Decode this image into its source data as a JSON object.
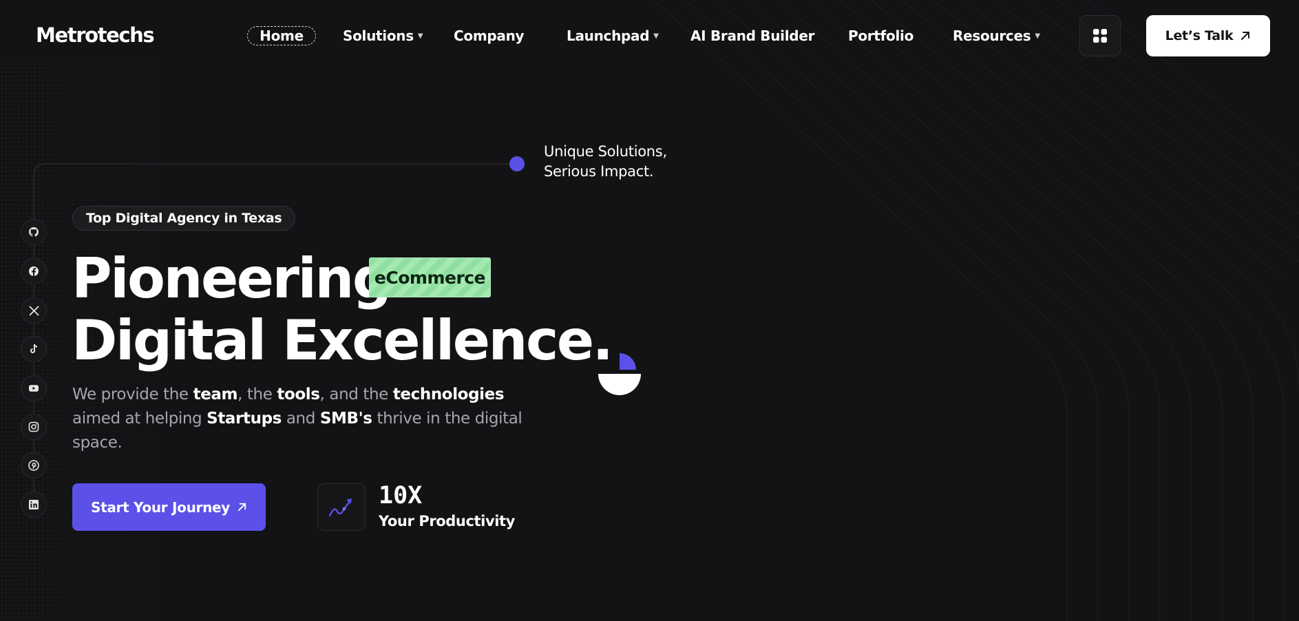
{
  "brand": {
    "logo": "Metrotechs"
  },
  "nav": {
    "items": [
      {
        "label": "Home",
        "has_dropdown": false,
        "active": true
      },
      {
        "label": "Solutions",
        "has_dropdown": true
      },
      {
        "label": "Company",
        "has_dropdown": false
      },
      {
        "label": "Launchpad",
        "has_dropdown": true
      },
      {
        "label": "AI Brand Builder",
        "has_dropdown": false
      },
      {
        "label": "Portfolio",
        "has_dropdown": false
      },
      {
        "label": "Resources",
        "has_dropdown": true
      }
    ],
    "menu_icon": "grid-icon",
    "cta_label": "Let’s Talk",
    "cta_icon": "arrow-up-right-icon"
  },
  "hero": {
    "tagline_line1": "Unique Solutions,",
    "tagline_line2": "Serious Impact.",
    "badge": "Top Digital Agency in Texas",
    "headline_line1": "Pioneering",
    "headline_highlight": "eCommerce",
    "headline_line2": "Digital Excellence.",
    "description": {
      "p1": "We provide the ",
      "b1": "team",
      "p2": ", the ",
      "b2": "tools",
      "p3": ", and the ",
      "b3": "technologies",
      "p4": " aimed at helping ",
      "b4": "Startups",
      "p5": " and ",
      "b5": "SMB's",
      "p6": " thrive in the digital space."
    },
    "cta_label": "Start Your Journey",
    "stat_value": "10X",
    "stat_label": "Your Productivity",
    "stat_icon": "trending-up-icon"
  },
  "social": [
    {
      "name": "github-icon"
    },
    {
      "name": "facebook-icon"
    },
    {
      "name": "x-twitter-icon"
    },
    {
      "name": "tiktok-icon"
    },
    {
      "name": "youtube-icon"
    },
    {
      "name": "instagram-icon"
    },
    {
      "name": "pinterest-icon"
    },
    {
      "name": "linkedin-icon"
    }
  ],
  "colors": {
    "background": "#131315",
    "accent": "#5b51e8",
    "highlight_green": "#9ae4ab",
    "text": "#ffffff",
    "muted_text": "#a6a6ad"
  }
}
